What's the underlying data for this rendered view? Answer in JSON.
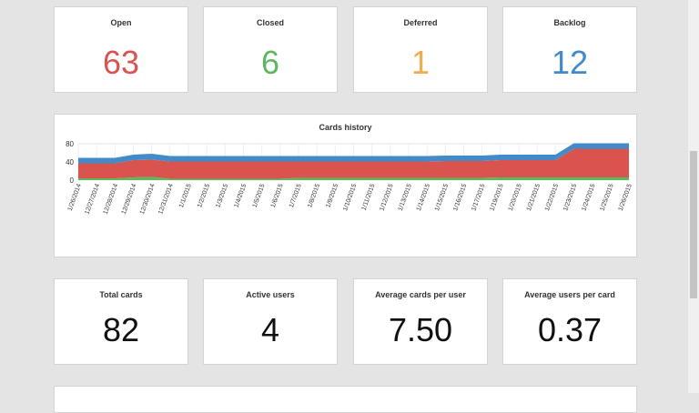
{
  "stats_top": [
    {
      "label": "Open",
      "value": "63",
      "color": "#d9534f"
    },
    {
      "label": "Closed",
      "value": "6",
      "color": "#5cb85c"
    },
    {
      "label": "Deferred",
      "value": "1",
      "color": "#f0ad4e"
    },
    {
      "label": "Backlog",
      "value": "12",
      "color": "#428bca"
    }
  ],
  "stats_bottom": [
    {
      "label": "Total cards",
      "value": "82"
    },
    {
      "label": "Active users",
      "value": "4"
    },
    {
      "label": "Average cards per user",
      "value": "7.50"
    },
    {
      "label": "Average users per card",
      "value": "0.37"
    }
  ],
  "chart_data": {
    "type": "area",
    "title": "Cards history",
    "stacked": true,
    "ylim": [
      0,
      80
    ],
    "yticks": [
      "0",
      "40",
      "80"
    ],
    "categories": [
      "1/26/2014",
      "12/27/2014",
      "12/28/2014",
      "12/29/2014",
      "12/30/2014",
      "12/31/2014",
      "1/1/2015",
      "1/2/2015",
      "1/3/2015",
      "1/4/2015",
      "1/5/2015",
      "1/6/2015",
      "1/7/2015",
      "1/8/2015",
      "1/9/2015",
      "1/10/2015",
      "1/11/2015",
      "1/12/2015",
      "1/13/2015",
      "1/14/2015",
      "1/15/2015",
      "1/16/2015",
      "1/17/2015",
      "1/19/2015",
      "1/20/2015",
      "1/21/2015",
      "1/22/2015",
      "1/23/2015",
      "1/24/2015",
      "1/25/2015",
      "1/26/2015"
    ],
    "series": [
      {
        "color": "#5cb85c",
        "values": [
          4,
          4,
          4,
          6,
          7,
          3,
          3,
          3,
          3,
          3,
          3,
          3,
          5,
          5,
          5,
          5,
          5,
          5,
          5,
          5,
          5,
          5,
          5,
          6,
          6,
          6,
          6,
          6,
          6,
          6,
          6
        ]
      },
      {
        "color": "#d9534f",
        "values": [
          33,
          33,
          33,
          38,
          38,
          38,
          38,
          38,
          38,
          38,
          38,
          38,
          36,
          36,
          36,
          36,
          36,
          36,
          36,
          36,
          37,
          37,
          37,
          38,
          38,
          38,
          38,
          63,
          63,
          63,
          63
        ]
      },
      {
        "color": "#428bca",
        "values": [
          12,
          12,
          12,
          12,
          13,
          12,
          12,
          12,
          12,
          12,
          12,
          12,
          12,
          12,
          12,
          12,
          12,
          12,
          12,
          12,
          12,
          12,
          12,
          12,
          12,
          12,
          12,
          12,
          12,
          12,
          12
        ]
      }
    ],
    "grid": true
  }
}
